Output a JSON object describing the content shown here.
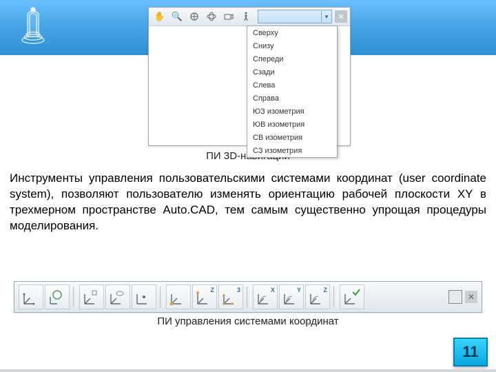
{
  "header": {
    "logo_name": "building-logo-icon"
  },
  "nav_panel": {
    "tools": [
      "hand-icon",
      "zoom-icon",
      "orbit-icon",
      "orbit-free-icon",
      "camera-icon",
      "walk-icon"
    ],
    "dropdown_items": [
      "Сверху",
      "Снизу",
      "Спереди",
      "Сзади",
      "Слева",
      "Справа",
      "ЮЗ изометрия",
      "ЮВ изометрия",
      "СВ изометрия",
      "СЗ изометрия"
    ]
  },
  "caption1": "ПИ 3D-навигации",
  "paragraph": "Инструменты управления пользовательскими системами координат (user coordinate system), позволяют пользователю изменять ориентацию рабочей плоскости XY в трехмерном пространстве Auto.CAD, тем самым существенно упрощая процедуры моделирования.",
  "ucs_buttons": [
    {
      "name": "ucs-world",
      "letter": ""
    },
    {
      "name": "ucs-previous",
      "letter": ""
    },
    {
      "name": "ucs-face",
      "letter": ""
    },
    {
      "name": "ucs-object",
      "letter": ""
    },
    {
      "name": "ucs-view",
      "letter": ""
    },
    {
      "name": "ucs-origin",
      "letter": ""
    },
    {
      "name": "ucs-zaxis",
      "letter": ""
    },
    {
      "name": "ucs-3point",
      "letter": ""
    },
    {
      "name": "ucs-x",
      "letter": "X"
    },
    {
      "name": "ucs-y",
      "letter": "Y"
    },
    {
      "name": "ucs-z",
      "letter": "Z"
    },
    {
      "name": "ucs-apply",
      "letter": ""
    }
  ],
  "caption2": "ПИ управления системами координат",
  "page_number": "11"
}
